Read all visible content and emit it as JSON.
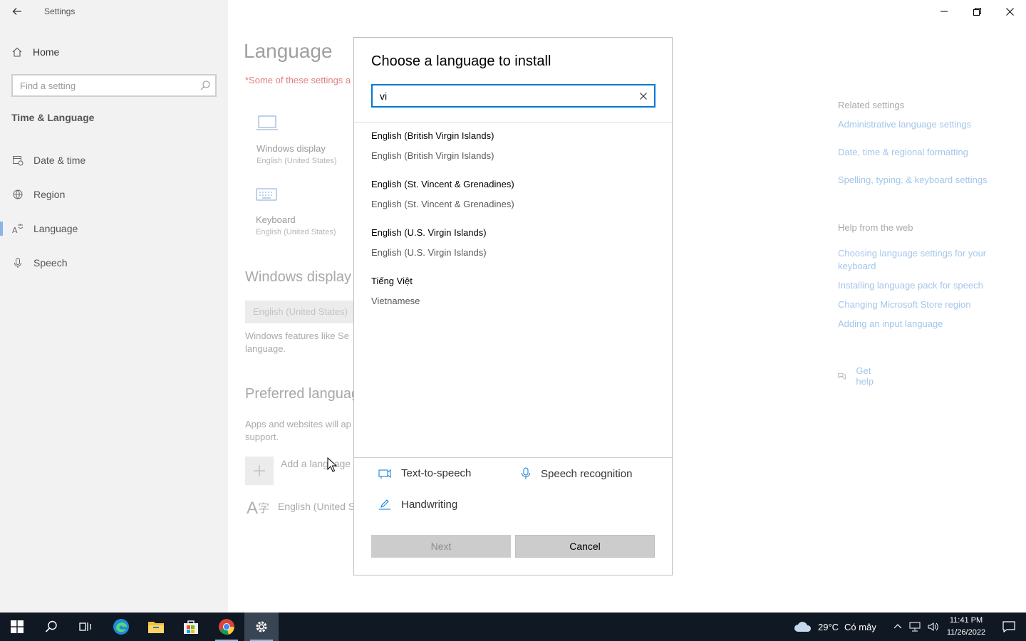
{
  "window": {
    "title": "Settings"
  },
  "sidebar": {
    "home_label": "Home",
    "search_placeholder": "Find a setting",
    "section_title": "Time & Language",
    "items": [
      {
        "label": "Date & time",
        "icon": "calendar-clock-icon"
      },
      {
        "label": "Region",
        "icon": "globe-icon"
      },
      {
        "label": "Language",
        "icon": "language-icon",
        "active": true
      },
      {
        "label": "Speech",
        "icon": "microphone-icon"
      }
    ]
  },
  "main": {
    "title": "Language",
    "warning": "*Some of these settings a",
    "tiles": [
      {
        "label": "Windows display",
        "sub": "English (United States)",
        "icon": "laptop-icon"
      },
      {
        "label": "Keyboard",
        "sub": "English (United States)",
        "icon": "keyboard-icon"
      }
    ],
    "display_heading": "Windows display",
    "display_value": "English (United States)",
    "display_desc": "Windows features like Se language.",
    "preferred_heading": "Preferred languag",
    "preferred_desc": "Apps and websites will ap support.",
    "add_language_label": "Add a language",
    "installed_language": "English (United St"
  },
  "related": {
    "heading": "Related settings",
    "links": [
      "Administrative language settings",
      "Date, time & regional formatting",
      "Spelling, typing, & keyboard settings"
    ],
    "help_heading": "Help from the web",
    "help_links": [
      "Choosing language settings for your keyboard",
      "Installing language pack for speech",
      "Changing Microsoft Store region",
      "Adding an input language"
    ],
    "get_help": "Get help"
  },
  "dialog": {
    "title": "Choose a language to install",
    "search_value": "vi",
    "languages": [
      {
        "native": "English (British Virgin Islands)",
        "english": "English (British Virgin Islands)"
      },
      {
        "native": "English (St. Vincent & Grenadines)",
        "english": "English (St. Vincent & Grenadines)"
      },
      {
        "native": "English (U.S. Virgin Islands)",
        "english": "English (U.S. Virgin Islands)"
      },
      {
        "native": "Tiếng Việt",
        "english": "Vietnamese"
      }
    ],
    "features": {
      "tts": "Text-to-speech",
      "speech": "Speech recognition",
      "handwriting": "Handwriting"
    },
    "next_label": "Next",
    "cancel_label": "Cancel"
  },
  "taskbar": {
    "weather_temp": "29°C",
    "weather_desc": "Có mây",
    "time": "11:41 PM",
    "date": "11/26/2022"
  },
  "colors": {
    "accent": "#0078d7",
    "link": "#a3c6ea",
    "taskbar": "#101824"
  }
}
